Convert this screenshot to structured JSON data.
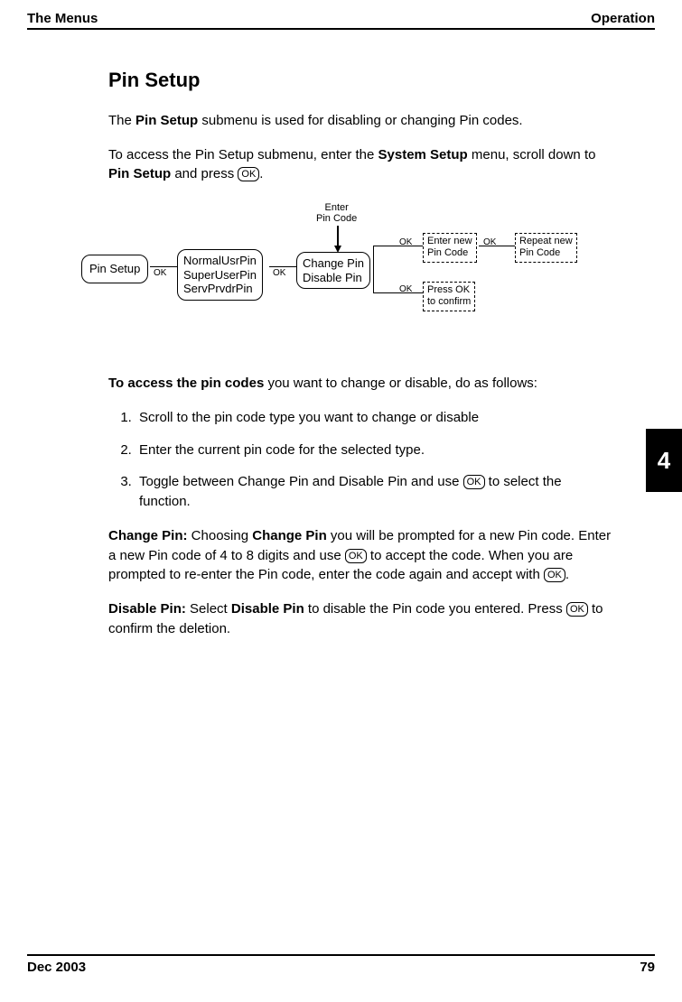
{
  "header": {
    "left": "The Menus",
    "right": "Operation"
  },
  "tab": "4",
  "footer": {
    "left": "Dec 2003",
    "right": "79"
  },
  "title": "Pin Setup",
  "intro": {
    "p1a": "The ",
    "p1b": "Pin Setup",
    "p1c": "  submenu is used for disabling or changing Pin codes.",
    "p2a": "To access the Pin Setup submenu, enter the ",
    "p2b": "System Setup",
    "p2c": " menu, scroll down to ",
    "p2d": "Pin Setup",
    "p2e": " and press ",
    "p2f": "."
  },
  "diagram": {
    "enter_label_l1": "Enter",
    "enter_label_l2": "Pin Code",
    "n1": "Pin Setup",
    "n2_l1": "NormalUsrPin",
    "n2_l2": "SuperUserPin",
    "n2_l3": "ServPrvdrPin",
    "n3_l1": "Change Pin",
    "n3_l2": "Disable Pin",
    "n4_l1": "Enter new",
    "n4_l2": "Pin Code",
    "n5_l1": "Repeat new",
    "n5_l2": "Pin Code",
    "n6_l1": "Press OK",
    "n6_l2": "to confirm",
    "ok": "OK"
  },
  "access": {
    "lead_a": "To access the pin codes",
    "lead_b": " you want to change or disable, do as follows:",
    "s1": "Scroll to the pin code type you want to change or disable",
    "s2": "Enter the current pin code for the selected type.",
    "s3a": "Toggle between Change Pin and Disable Pin and use ",
    "s3b": " to select the function."
  },
  "change": {
    "h": "Change Pin:",
    "a": " Choosing ",
    "b": "Change Pin",
    "c": " you will be prompted for a new Pin code. Enter a new Pin code of 4 to 8 digits and use ",
    "d": " to accept the code. When you are prompted to re-enter the Pin code, enter the code again and accept with ",
    "e": "."
  },
  "disable": {
    "h": "Disable Pin:",
    "a": " Select ",
    "b": "Disable Pin",
    "c": " to disable the Pin code you entered. Press ",
    "d": " to confirm the deletion."
  },
  "okbtn": "OK"
}
